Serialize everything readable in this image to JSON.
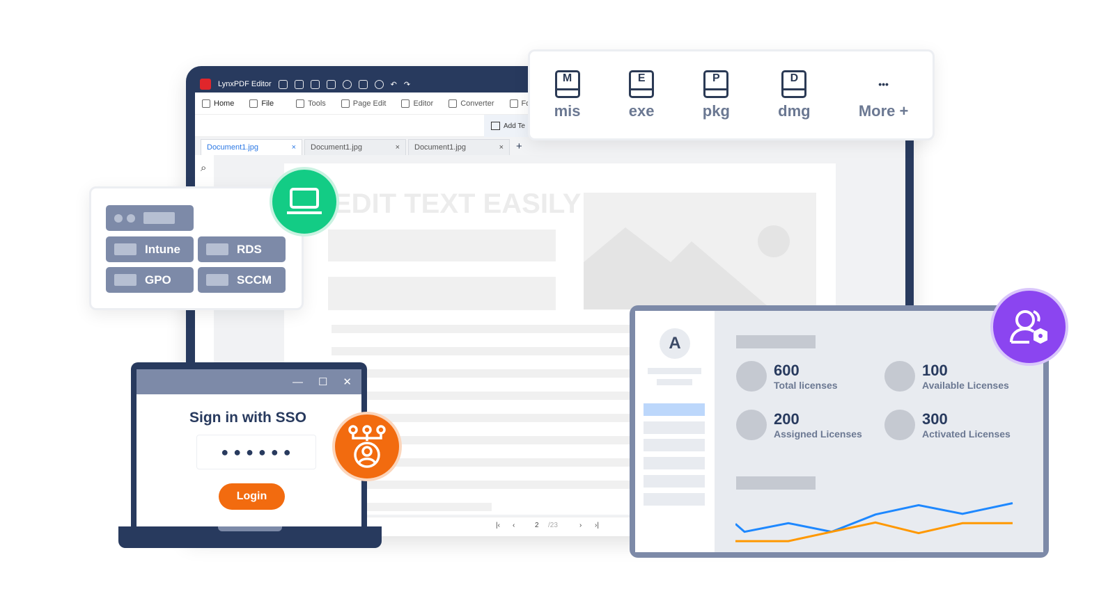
{
  "editor": {
    "app_title": "LynxPDF Editor",
    "ribbon": [
      "Home",
      "File",
      "Tools",
      "Page Edit",
      "Editor",
      "Converter",
      "Form"
    ],
    "add_text": "Add Te",
    "tabs": [
      {
        "label": "Document1.jpg",
        "active": true
      },
      {
        "label": "Document1.jpg"
      },
      {
        "label": "Document1.jpg"
      }
    ],
    "new_tab": "+",
    "close": "×",
    "page_heading": "EDIT TEXT EASILY",
    "pager": {
      "current": "2",
      "total": "/23"
    }
  },
  "formats": [
    {
      "letter": "M",
      "label": "mis"
    },
    {
      "letter": "E",
      "label": "exe"
    },
    {
      "letter": "P",
      "label": "pkg"
    },
    {
      "letter": "D",
      "label": "dmg"
    },
    {
      "letter": "•••",
      "label": "More +"
    }
  ],
  "deploy": [
    "Intune",
    "RDS",
    "GPO",
    "SCCM"
  ],
  "sso": {
    "title": "Sign in with SSO",
    "password_dots": "● ● ● ● ● ●",
    "login": "Login",
    "min": "—",
    "max": "☐",
    "close": "✕"
  },
  "dashboard": {
    "avatar": "A",
    "stats": [
      {
        "value": "600",
        "label": "Total licenses"
      },
      {
        "value": "100",
        "label": "Available Licenses"
      },
      {
        "value": "200",
        "label": "Assigned Licenses"
      },
      {
        "value": "300",
        "label": "Activated Licenses"
      }
    ]
  },
  "colors": {
    "navy": "#283a5e",
    "green": "#13cc85",
    "orange": "#f26b0f",
    "purple": "#8b45f0",
    "blue_line": "#1e88ff",
    "orange_line": "#ff9800"
  },
  "chart_data": {
    "type": "line",
    "series": [
      {
        "values": [
          28,
          16,
          29,
          16,
          42,
          56,
          43,
          59
        ],
        "color": "#1e88ff"
      },
      {
        "values": [
          2,
          2,
          2,
          16,
          30,
          14,
          29,
          29
        ],
        "color": "#ff9800"
      }
    ],
    "ylim": [
      0,
      70
    ]
  }
}
